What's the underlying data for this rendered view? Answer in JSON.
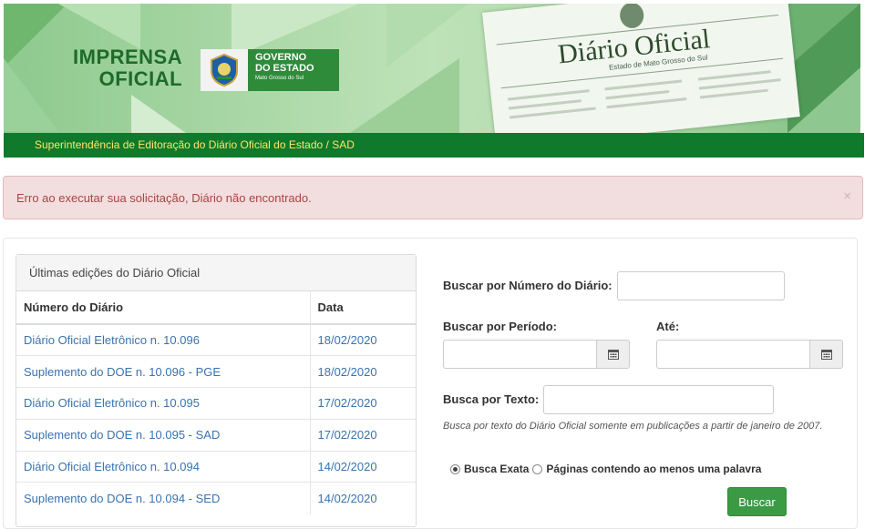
{
  "header": {
    "brand_line1": "IMPRENSA",
    "brand_line2": "OFICIAL",
    "gov_line1": "GOVERNO",
    "gov_line2": "DO ESTADO",
    "gov_line3": "Mato Grosso do Sul",
    "paper_title": "Diário Oficial",
    "paper_subtitle": "Estado de Mato Grosso do Sul",
    "subbar": "Superintendência de Editoração do Diário Oficial do Estado / SAD"
  },
  "alert": {
    "message": "Erro ao executar sua solicitação, Diário não encontrado.",
    "close": "×"
  },
  "editions": {
    "title": "Últimas edições do Diário Oficial",
    "headers": [
      "Número do Diário",
      "Data"
    ],
    "rows": [
      {
        "name": "Diário Oficial Eletrônico n. 10.096",
        "date": "18/02/2020"
      },
      {
        "name": "Suplemento do DOE n. 10.096 - PGE",
        "date": "18/02/2020"
      },
      {
        "name": "Diário Oficial Eletrônico n. 10.095",
        "date": "17/02/2020"
      },
      {
        "name": "Suplemento do DOE n. 10.095 - SAD",
        "date": "17/02/2020"
      },
      {
        "name": "Diário Oficial Eletrônico n. 10.094",
        "date": "14/02/2020"
      },
      {
        "name": "Suplemento do DOE n. 10.094 - SED",
        "date": "14/02/2020"
      }
    ]
  },
  "search": {
    "numero_label": "Buscar por Número do Diário:",
    "periodo_label": "Buscar por Período:",
    "ate_label": "Até:",
    "texto_label": "Busca por Texto:",
    "hint": "Busca por texto do Diário Oficial somente em publicações a partir de janeiro de 2007.",
    "radio_exact": "Busca Exata",
    "radio_any": "Páginas contendo ao menos uma palavra",
    "radio_selected": "exact",
    "button": "Buscar"
  }
}
